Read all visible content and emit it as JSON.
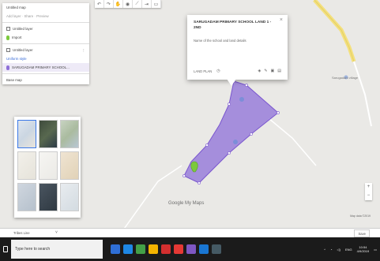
{
  "panel": {
    "title": "Untitled map",
    "row2": "Add layer · Share · Preview",
    "layer1_title": "Untitled layer",
    "layer1_sub": "Import",
    "layer2_title": "Untitled layer",
    "layer2_sub": "Uniform style",
    "layer2_item": "SARUGADAM PRIMARY SCHOOL...",
    "basemap_label": "Base map"
  },
  "popup": {
    "title": "SARUGADAM PRIMARY SCHOOL LAND 1 - 2nd",
    "description": "Name of the school and land details",
    "foot_text": "LAND PLAN",
    "close": "×"
  },
  "map": {
    "logo": "Google My Maps",
    "attribution": "Map data ©2019",
    "place_label": "Sarugadam village"
  },
  "statusbar": {
    "label": "Tribes Line",
    "button": "Save"
  },
  "taskbar": {
    "search_placeholder": "Type here to search",
    "time": "10:54",
    "date": "4/9/2019",
    "tray_text": "ENG"
  },
  "colors": {
    "polygon_fill": "#8e6fd8",
    "polygon_stroke": "#7a56cf",
    "road_yellow": "#f4e07c",
    "pin_green": "#7cc93c"
  }
}
